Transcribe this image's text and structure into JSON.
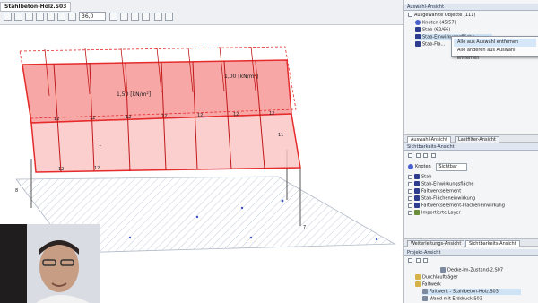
{
  "document_tab": "Stahlbeton-Holz.S03",
  "toolbar": {
    "zoom_value": "36,0"
  },
  "model": {
    "loads": [
      "1,50 [kN/m²]",
      "1,00 [kN/m²]"
    ],
    "member_labels": [
      "12",
      "12",
      "12",
      "12",
      "12",
      "12",
      "12",
      "12",
      "12",
      "1",
      "1",
      "1",
      "11",
      "12",
      "12",
      "12",
      "12"
    ],
    "side_labels": [
      "8",
      "7"
    ]
  },
  "selection_panel": {
    "title": "Auswahl-Ansicht",
    "root": "Ausgewählte Objekte (111)",
    "items": [
      "Knoten (45/57)",
      "Stab (62/66)",
      "Stab-Einwirkungsfläche",
      "Stab-Fla..."
    ]
  },
  "context_menu": {
    "items": [
      "Alle aus Auswahl entfernen",
      "Alle anderen aus Auswahl entfernen"
    ]
  },
  "tabs_top": [
    "Auswahl-Ansicht",
    "Lastfilter-Ansicht"
  ],
  "visibility_panel": {
    "title": "Sichtbarkeits-Ansicht",
    "filter_label": "Knoten",
    "filter_value": "Sichtbar",
    "items": [
      "Stab",
      "Stab-Einwirkungsfläche",
      "Faltwerkselement",
      "Stab-Flächeneinwirkung",
      "Faltwerkselement-Flächeneinwirkung",
      "Importierte Layer"
    ]
  },
  "tabs_bottom": [
    "Weiterleitungs-Ansicht",
    "Sichtbarkeits-Ansicht"
  ],
  "project_panel": {
    "title": "Projekt-Ansicht",
    "items": [
      "Decke-im-Zustand-2.S07",
      "Durchlaufträger",
      "Faltwerk",
      "Faltwerk - Stahlbeton-Holz.S03",
      "Wand mit Erddruck.S03"
    ]
  },
  "colors": {
    "accent": "#e52b2b",
    "fill": "#f58a8a",
    "panel_header": "#dfe6ef",
    "selection": "#cfe3f7"
  }
}
